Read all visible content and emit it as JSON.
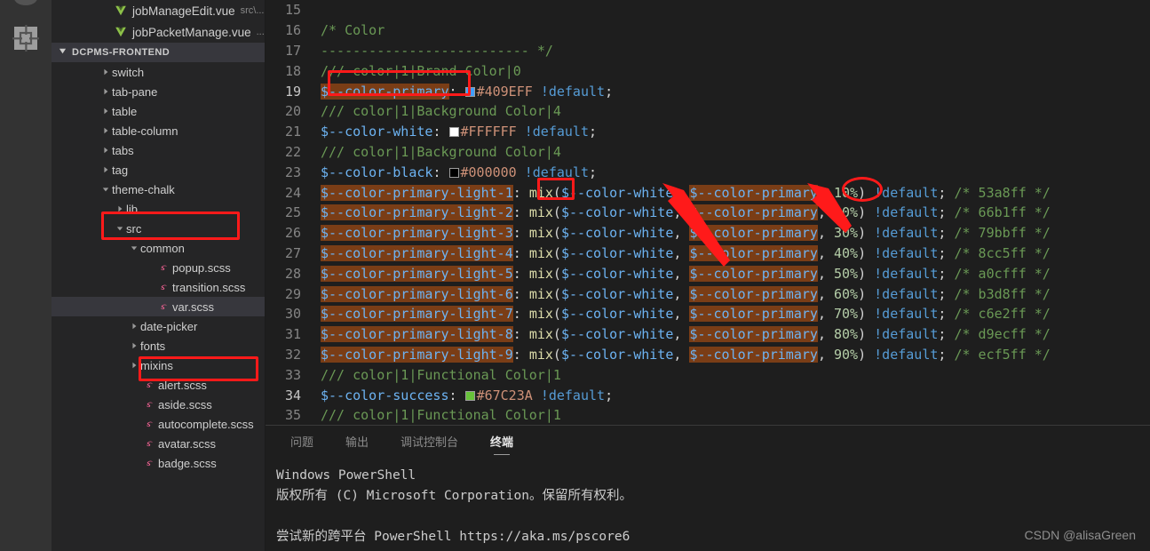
{
  "app": {
    "theme_bg": "#1e1e1e",
    "sidebar_bg": "#252526",
    "activitybar_bg": "#333333",
    "accent_red": "#ff1a1a",
    "selection_brown": "#7a3d16"
  },
  "activitybar": {
    "icons": [
      {
        "name": "extensions-icon",
        "label": "Extensions"
      }
    ]
  },
  "sidebar": {
    "open_editors": [
      {
        "icon": "vue-file-icon",
        "name": "jobManageEdit.vue",
        "path": "src\\..."
      },
      {
        "icon": "vue-file-icon",
        "name": "jobPacketManage.vue",
        "path": "..."
      }
    ],
    "section_header": {
      "label": "DCPMS-FRONTEND",
      "twisty": "▼"
    },
    "tree": [
      {
        "label": "switch",
        "indent": 2,
        "twisty": "▶",
        "icon": "",
        "selected": false,
        "boxed": false
      },
      {
        "label": "tab-pane",
        "indent": 2,
        "twisty": "▶",
        "icon": "",
        "selected": false,
        "boxed": false
      },
      {
        "label": "table",
        "indent": 2,
        "twisty": "▶",
        "icon": "",
        "selected": false,
        "boxed": false
      },
      {
        "label": "table-column",
        "indent": 2,
        "twisty": "▶",
        "icon": "",
        "selected": false,
        "boxed": false
      },
      {
        "label": "tabs",
        "indent": 2,
        "twisty": "▶",
        "icon": "",
        "selected": false,
        "boxed": false
      },
      {
        "label": "tag",
        "indent": 2,
        "twisty": "▶",
        "icon": "",
        "selected": false,
        "boxed": false
      },
      {
        "label": "theme-chalk",
        "indent": 2,
        "twisty": "▼",
        "icon": "",
        "selected": false,
        "boxed": true
      },
      {
        "label": "lib",
        "indent": 3,
        "twisty": "▶",
        "icon": "",
        "selected": false,
        "boxed": false
      },
      {
        "label": "src",
        "indent": 3,
        "twisty": "▼",
        "icon": "",
        "selected": false,
        "boxed": false
      },
      {
        "label": "common",
        "indent": 4,
        "twisty": "▼",
        "icon": "",
        "selected": false,
        "boxed": false
      },
      {
        "label": "popup.scss",
        "indent": 5,
        "twisty": "",
        "icon": "sass-file-icon",
        "selected": false,
        "boxed": false
      },
      {
        "label": "transition.scss",
        "indent": 5,
        "twisty": "",
        "icon": "sass-file-icon",
        "selected": false,
        "boxed": false
      },
      {
        "label": "var.scss",
        "indent": 5,
        "twisty": "",
        "icon": "sass-file-icon",
        "selected": true,
        "boxed": true
      },
      {
        "label": "date-picker",
        "indent": 4,
        "twisty": "▶",
        "icon": "",
        "selected": false,
        "boxed": false
      },
      {
        "label": "fonts",
        "indent": 4,
        "twisty": "▶",
        "icon": "",
        "selected": false,
        "boxed": false
      },
      {
        "label": "mixins",
        "indent": 4,
        "twisty": "▶",
        "icon": "",
        "selected": false,
        "boxed": false
      },
      {
        "label": "alert.scss",
        "indent": 4,
        "twisty": "",
        "icon": "sass-file-icon",
        "selected": false,
        "boxed": false
      },
      {
        "label": "aside.scss",
        "indent": 4,
        "twisty": "",
        "icon": "sass-file-icon",
        "selected": false,
        "boxed": false
      },
      {
        "label": "autocomplete.scss",
        "indent": 4,
        "twisty": "",
        "icon": "sass-file-icon",
        "selected": false,
        "boxed": false
      },
      {
        "label": "avatar.scss",
        "indent": 4,
        "twisty": "",
        "icon": "sass-file-icon",
        "selected": false,
        "boxed": false
      },
      {
        "label": "badge.scss",
        "indent": 4,
        "twisty": "",
        "icon": "sass-file-icon",
        "selected": false,
        "boxed": false
      }
    ]
  },
  "editor": {
    "file": "var.scss",
    "first_line": 15,
    "lines": [
      {
        "n": 15,
        "text": ""
      },
      {
        "n": 16,
        "text": "/* Color"
      },
      {
        "n": 17,
        "text": "-------------------------- */"
      },
      {
        "n": 18,
        "text": "/// color|1|Brand Color|0"
      },
      {
        "n": 19,
        "text": "$--color-primary: #409EFF !default;"
      },
      {
        "n": 20,
        "text": "/// color|1|Background Color|4"
      },
      {
        "n": 21,
        "text": "$--color-white: #FFFFFF !default;"
      },
      {
        "n": 22,
        "text": "/// color|1|Background Color|4"
      },
      {
        "n": 23,
        "text": "$--color-black: #000000 !default;"
      },
      {
        "n": 24,
        "text": "$--color-primary-light-1: mix($--color-white, $--color-primary, 10%) !default; /* 53a8ff */"
      },
      {
        "n": 25,
        "text": "$--color-primary-light-2: mix($--color-white, $--color-primary, 20%) !default; /* 66b1ff */"
      },
      {
        "n": 26,
        "text": "$--color-primary-light-3: mix($--color-white, $--color-primary, 30%) !default; /* 79bbff */"
      },
      {
        "n": 27,
        "text": "$--color-primary-light-4: mix($--color-white, $--color-primary, 40%) !default; /* 8cc5ff */"
      },
      {
        "n": 28,
        "text": "$--color-primary-light-5: mix($--color-white, $--color-primary, 50%) !default; /* a0cfff */"
      },
      {
        "n": 29,
        "text": "$--color-primary-light-6: mix($--color-white, $--color-primary, 60%) !default; /* b3d8ff */"
      },
      {
        "n": 30,
        "text": "$--color-primary-light-7: mix($--color-white, $--color-primary, 70%) !default; /* c6e2ff */"
      },
      {
        "n": 31,
        "text": "$--color-primary-light-8: mix($--color-white, $--color-primary, 80%) !default; /* d9ecff */"
      },
      {
        "n": 32,
        "text": "$--color-primary-light-9: mix($--color-white, $--color-primary, 90%) !default; /* ecf5ff */"
      },
      {
        "n": 33,
        "text": "/// color|1|Functional Color|1"
      },
      {
        "n": 34,
        "text": "$--color-success: #67C23A !default;"
      },
      {
        "n": 35,
        "text": "/// color|1|Functional Color|1"
      }
    ],
    "color_swatches": {
      "primary": "#409EFF",
      "white": "#FFFFFF",
      "black": "#000000",
      "success": "#67C23A"
    },
    "mix_percentages": [
      "10%",
      "20%",
      "30%",
      "40%",
      "50%",
      "60%",
      "70%",
      "80%",
      "90%"
    ],
    "result_hexes": [
      "53a8ff",
      "66b1ff",
      "79bbff",
      "8cc5ff",
      "a0cfff",
      "b3d8ff",
      "c6e2ff",
      "d9ecff",
      "ecf5ff"
    ]
  },
  "panel": {
    "tabs": [
      {
        "label": "问题",
        "active": false
      },
      {
        "label": "输出",
        "active": false
      },
      {
        "label": "调试控制台",
        "active": false
      },
      {
        "label": "终端",
        "active": true
      }
    ],
    "terminal_lines": [
      "Windows PowerShell",
      "版权所有 (C) Microsoft Corporation。保留所有权利。",
      "",
      "尝试新的跨平台 PowerShell https://aka.ms/pscore6"
    ]
  },
  "annotations": {
    "boxes": [
      {
        "name": "theme-chalk-highlight"
      },
      {
        "name": "var-scss-highlight"
      },
      {
        "name": "color-primary-declaration-highlight"
      },
      {
        "name": "mix-function-highlight"
      }
    ],
    "circle": {
      "name": "ten-percent-circle",
      "target": "10%"
    },
    "arrows": [
      {
        "name": "arrow-to-color-white"
      },
      {
        "name": "arrow-to-color-primary"
      }
    ]
  },
  "watermark": {
    "text": "CSDN @alisaGreen"
  }
}
